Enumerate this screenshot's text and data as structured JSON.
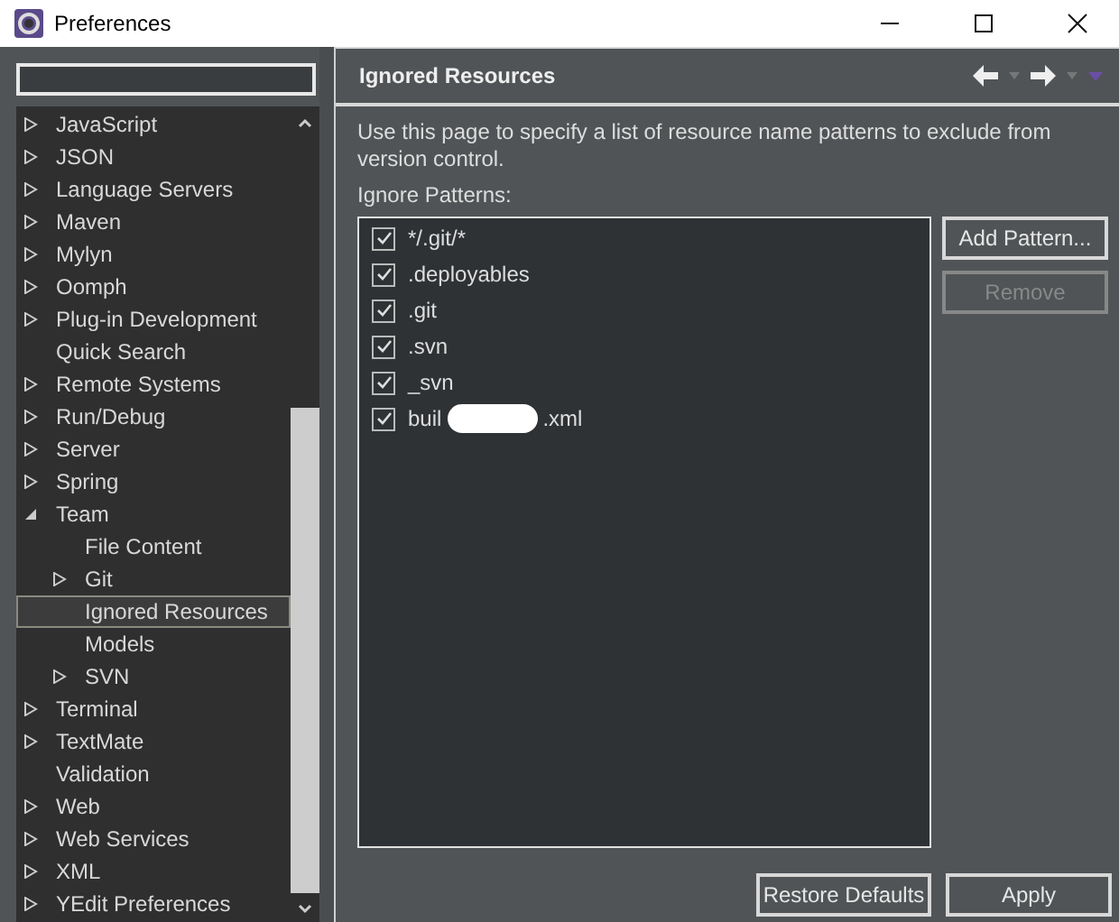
{
  "window": {
    "title": "Preferences"
  },
  "sidebar": {
    "items": [
      {
        "label": "JavaScript",
        "expandable": true,
        "expanded": false,
        "selected": false
      },
      {
        "label": "JSON",
        "expandable": true,
        "expanded": false,
        "selected": false
      },
      {
        "label": "Language Servers",
        "expandable": true,
        "expanded": false,
        "selected": false
      },
      {
        "label": "Maven",
        "expandable": true,
        "expanded": false,
        "selected": false
      },
      {
        "label": "Mylyn",
        "expandable": true,
        "expanded": false,
        "selected": false
      },
      {
        "label": "Oomph",
        "expandable": true,
        "expanded": false,
        "selected": false
      },
      {
        "label": "Plug-in Development",
        "expandable": true,
        "expanded": false,
        "selected": false
      },
      {
        "label": "Quick Search",
        "expandable": false,
        "selected": false
      },
      {
        "label": "Remote Systems",
        "expandable": true,
        "expanded": false,
        "selected": false
      },
      {
        "label": "Run/Debug",
        "expandable": true,
        "expanded": false,
        "selected": false
      },
      {
        "label": "Server",
        "expandable": true,
        "expanded": false,
        "selected": false
      },
      {
        "label": "Spring",
        "expandable": true,
        "expanded": false,
        "selected": false
      },
      {
        "label": "Team",
        "expandable": true,
        "expanded": true,
        "selected": false,
        "children": [
          {
            "label": "File Content",
            "expandable": false,
            "selected": false
          },
          {
            "label": "Git",
            "expandable": true,
            "expanded": false,
            "selected": false
          },
          {
            "label": "Ignored Resources",
            "expandable": false,
            "selected": true
          },
          {
            "label": "Models",
            "expandable": false,
            "selected": false
          },
          {
            "label": "SVN",
            "expandable": true,
            "expanded": false,
            "selected": false
          }
        ]
      },
      {
        "label": "Terminal",
        "expandable": true,
        "expanded": false,
        "selected": false
      },
      {
        "label": "TextMate",
        "expandable": true,
        "expanded": false,
        "selected": false
      },
      {
        "label": "Validation",
        "expandable": false,
        "selected": false
      },
      {
        "label": "Web",
        "expandable": true,
        "expanded": false,
        "selected": false
      },
      {
        "label": "Web Services",
        "expandable": true,
        "expanded": false,
        "selected": false
      },
      {
        "label": "XML",
        "expandable": true,
        "expanded": false,
        "selected": false
      },
      {
        "label": "YEdit Preferences",
        "expandable": true,
        "expanded": false,
        "selected": false
      }
    ]
  },
  "page": {
    "title": "Ignored Resources",
    "description": "Use this page to specify a list of resource name patterns to exclude from version control.",
    "patterns_label": "Ignore Patterns:",
    "patterns": [
      {
        "text": "*/.git/*",
        "checked": true
      },
      {
        "text": ".deployables",
        "checked": true
      },
      {
        "text": ".git",
        "checked": true
      },
      {
        "text": ".svn",
        "checked": true
      },
      {
        "text": "_svn",
        "checked": true
      },
      {
        "text": "buil",
        "text_after": ".xml",
        "redacted": true,
        "checked": true
      }
    ],
    "side_buttons": [
      {
        "label": "Add Pattern...",
        "disabled": false
      },
      {
        "label": "Remove",
        "disabled": true
      }
    ],
    "buttons": [
      {
        "label": "Restore Defaults"
      },
      {
        "label": "Apply"
      }
    ]
  }
}
